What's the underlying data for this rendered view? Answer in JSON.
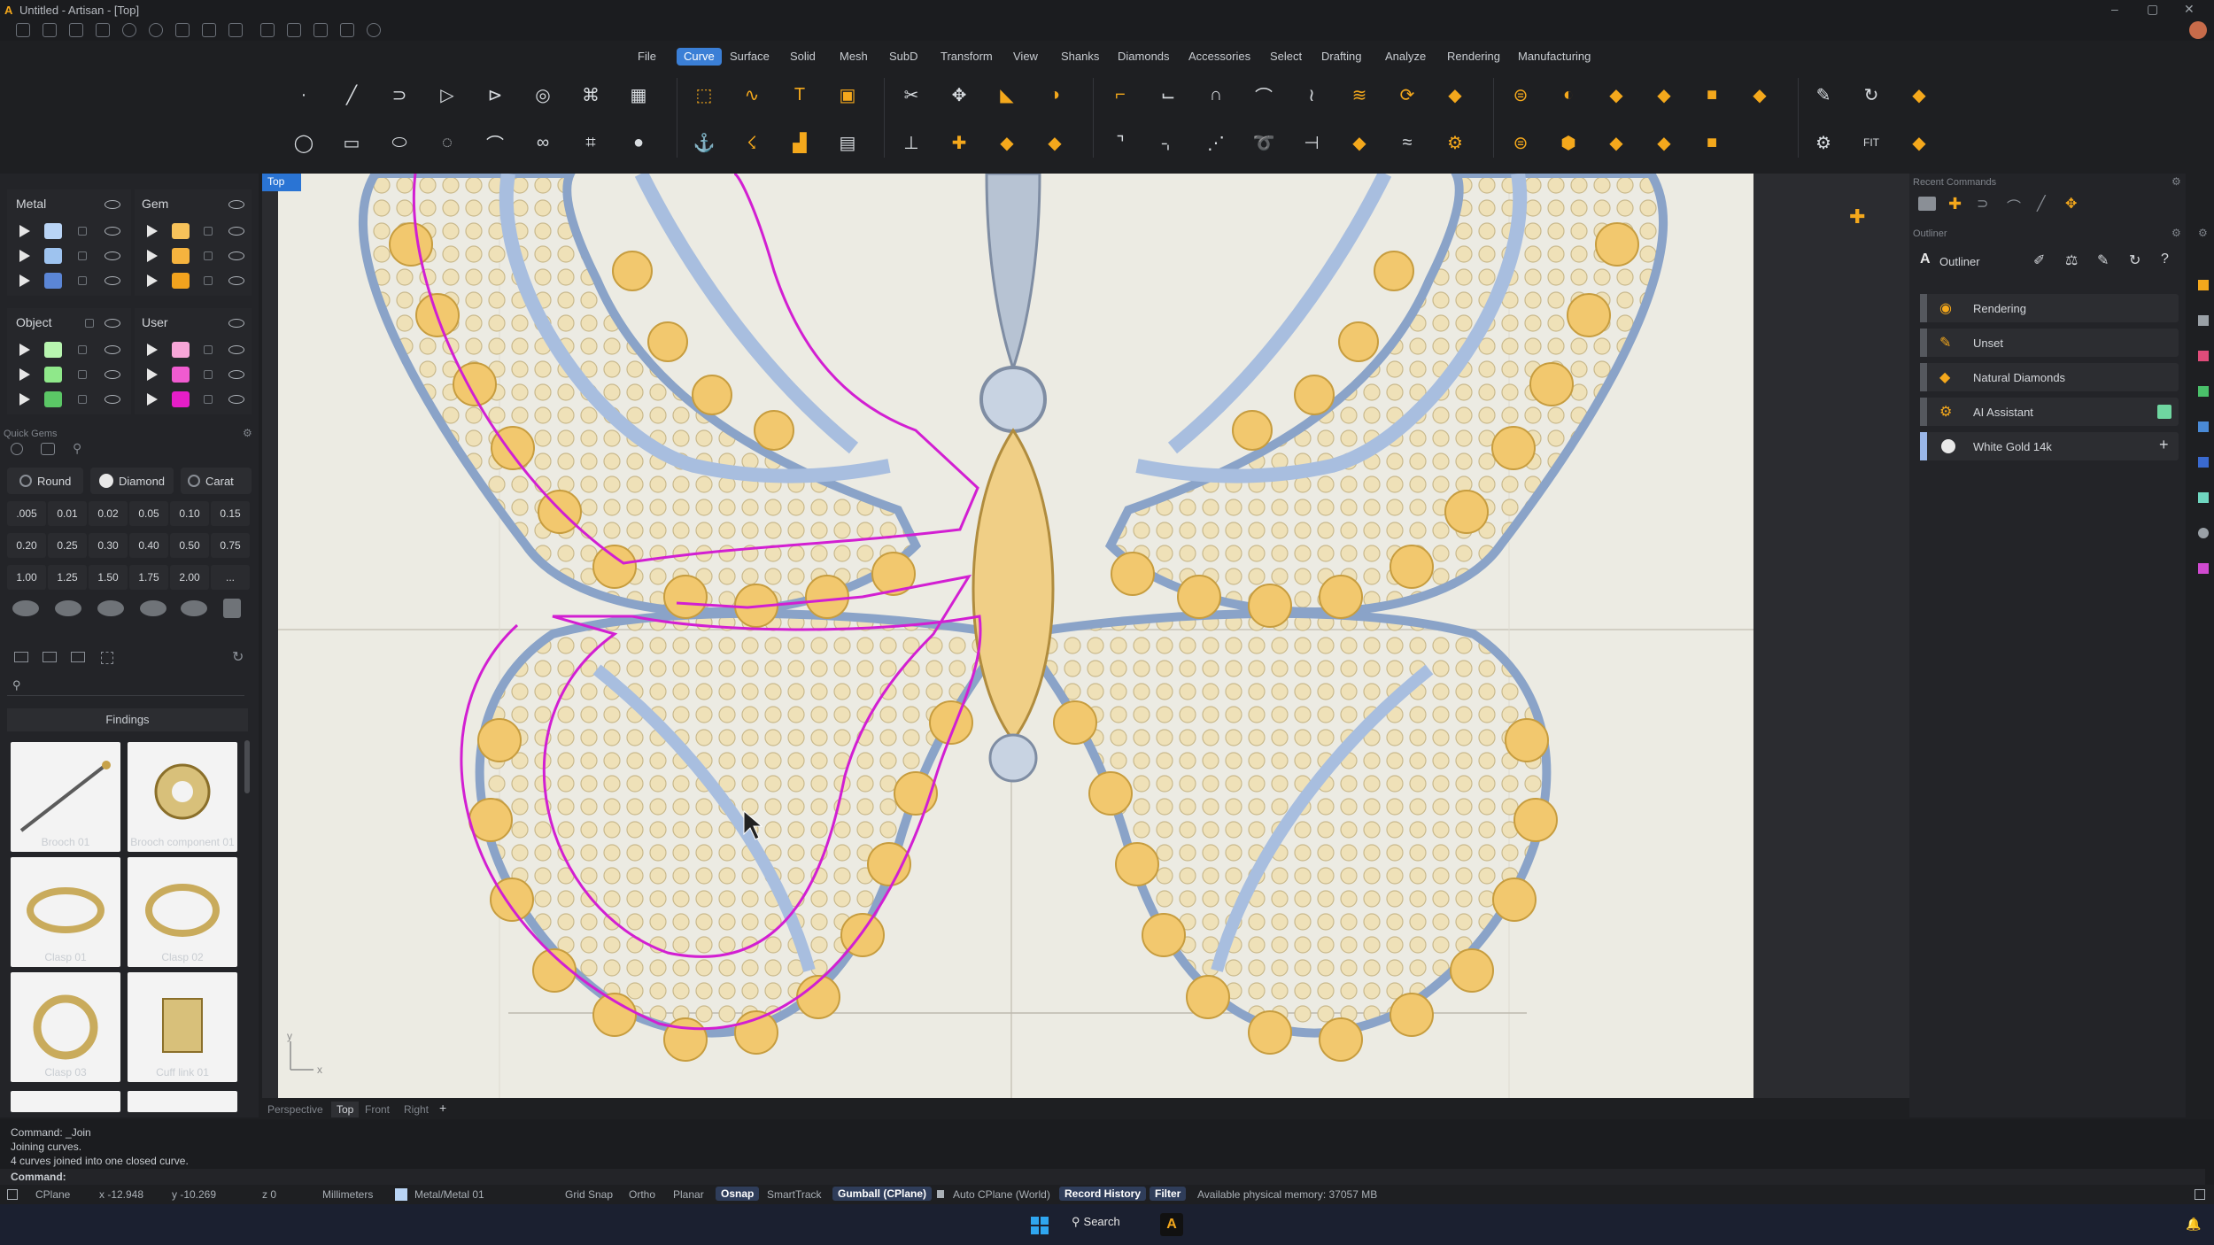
{
  "window": {
    "title": "Untitled - Artisan - [Top]"
  },
  "menus": [
    "File",
    "Curve",
    "Surface",
    "Solid",
    "Mesh",
    "SubD",
    "Transform",
    "View",
    "Shanks",
    "Diamonds",
    "Accessories",
    "Select",
    "Drafting",
    "Analyze",
    "Rendering",
    "Manufacturing"
  ],
  "active_menu": "Curve",
  "layers": {
    "metal": {
      "title": "Metal",
      "colors": [
        "#b9d4f5",
        "#9ec3ef",
        "#5b86d6"
      ]
    },
    "gem": {
      "title": "Gem",
      "colors": [
        "#f7c25a",
        "#f5b33e",
        "#f2a31e"
      ]
    },
    "object": {
      "title": "Object",
      "colors": [
        "#b8f5b0",
        "#8fe88a",
        "#5bc766"
      ]
    },
    "user": {
      "title": "User",
      "colors": [
        "#f7a6d8",
        "#f05bd0",
        "#e61ec8"
      ]
    }
  },
  "quick_gems": {
    "title": "Quick Gems",
    "shape": "Round",
    "material": "Diamond",
    "unit": "Carat",
    "sizes": [
      ".005",
      "0.01",
      "0.02",
      "0.05",
      "0.10",
      "0.15",
      "0.20",
      "0.25",
      "0.30",
      "0.40",
      "0.50",
      "0.75",
      "1.00",
      "1.25",
      "1.50",
      "1.75",
      "2.00",
      "..."
    ]
  },
  "library": {
    "category": "Findings",
    "items": [
      "Brooch 01",
      "Brooch component 01",
      "Clasp 01",
      "Clasp 02",
      "Clasp 03",
      "Cuff link 01"
    ]
  },
  "viewport": {
    "label": "Top",
    "tabs": [
      "Perspective",
      "Top",
      "Front",
      "Right"
    ],
    "active_tab": "Top"
  },
  "right_panel": {
    "recent_title": "Recent Commands",
    "outliner_title": "Outliner",
    "outliner_tab": "Outliner",
    "rows": [
      {
        "label": "Rendering",
        "color": "#f4a81c"
      },
      {
        "label": "Unset",
        "color": "#f4a81c"
      },
      {
        "label": "Natural Diamonds",
        "color": "#f4a81c"
      },
      {
        "label": "AI Assistant",
        "color": "#f4a81c"
      },
      {
        "label": "White Gold 14k",
        "color": "#e8e8e8"
      }
    ]
  },
  "command_history": [
    "Command: _Join",
    "Joining curves.",
    "4 curves joined into one closed curve."
  ],
  "command_prompt": "Command:",
  "status": {
    "cplane": "CPlane",
    "x": "x -12.948",
    "y": "y -10.269",
    "z": "z 0",
    "units": "Millimeters",
    "layer": "Metal/Metal 01",
    "grid_snap": "Grid Snap",
    "ortho": "Ortho",
    "planar": "Planar",
    "osnap": "Osnap",
    "smarttrack": "SmartTrack",
    "gumball": "Gumball (CPlane)",
    "auto_cplane": "Auto CPlane (World)",
    "record_history": "Record History",
    "filter": "Filter",
    "memory": "Available physical memory: 37057 MB"
  },
  "taskbar": {
    "search": "Search"
  },
  "axis": {
    "x": "x",
    "y": "y"
  }
}
